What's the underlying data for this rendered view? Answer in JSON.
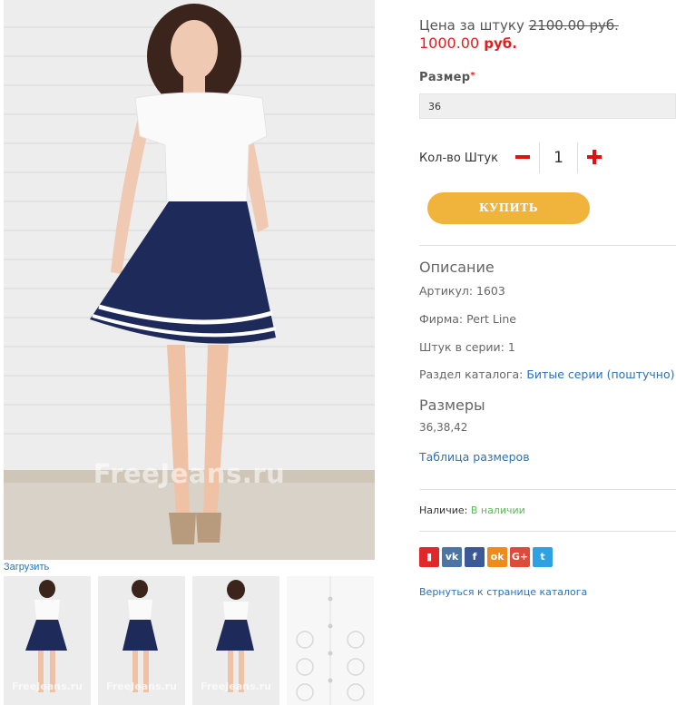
{
  "gallery": {
    "watermark": "FreeJeans.ru",
    "upload_label": "Загрузить",
    "thumbnails": [
      {
        "watermark": "FreeJeans.ru"
      },
      {
        "watermark": "FreeJeans.ru"
      },
      {
        "watermark": "FreeJeans.ru"
      },
      {
        "watermark": ""
      }
    ]
  },
  "price": {
    "label": "Цена за штуку",
    "old_price": "2100.00 руб.",
    "current_value": "1000.00",
    "current_unit": "руб."
  },
  "size": {
    "label": "Размер",
    "required_mark": "*",
    "selected": "36"
  },
  "quantity": {
    "label": "Кол-во Штук",
    "value": "1"
  },
  "buy_button": {
    "label": "КУПИТЬ"
  },
  "description": {
    "title": "Описание",
    "article_label": "Артикул:",
    "article_value": "1603",
    "brand_label": "Фирма:",
    "brand_value": "Pert Line",
    "series_label": "Штук в серии:",
    "series_value": "1",
    "catalog_label": "Раздел каталога:",
    "catalog_value": "Битые серии (поштучно)"
  },
  "sizes": {
    "title": "Размеры",
    "values": "36,38,42",
    "table_link": "Таблица размеров"
  },
  "availability": {
    "label": "Наличие:",
    "value": "В наличии"
  },
  "social": [
    {
      "name": "bookmark-icon",
      "glyph": "▮",
      "color": "#e0272a"
    },
    {
      "name": "vk-icon",
      "glyph": "vk",
      "color": "#4c75a3"
    },
    {
      "name": "facebook-icon",
      "glyph": "f",
      "color": "#3b5998"
    },
    {
      "name": "odnoklassniki-icon",
      "glyph": "ok",
      "color": "#f08a1c"
    },
    {
      "name": "google-plus-icon",
      "glyph": "G+",
      "color": "#dd4b39"
    },
    {
      "name": "twitter-icon",
      "glyph": "t",
      "color": "#2da1e1"
    }
  ],
  "back_link": "Вернуться к странице каталога",
  "colors": {
    "accent_button": "#f0b43c",
    "price_red": "#e02020",
    "link_blue": "#2a72b8",
    "in_stock_green": "#5cb85c"
  }
}
